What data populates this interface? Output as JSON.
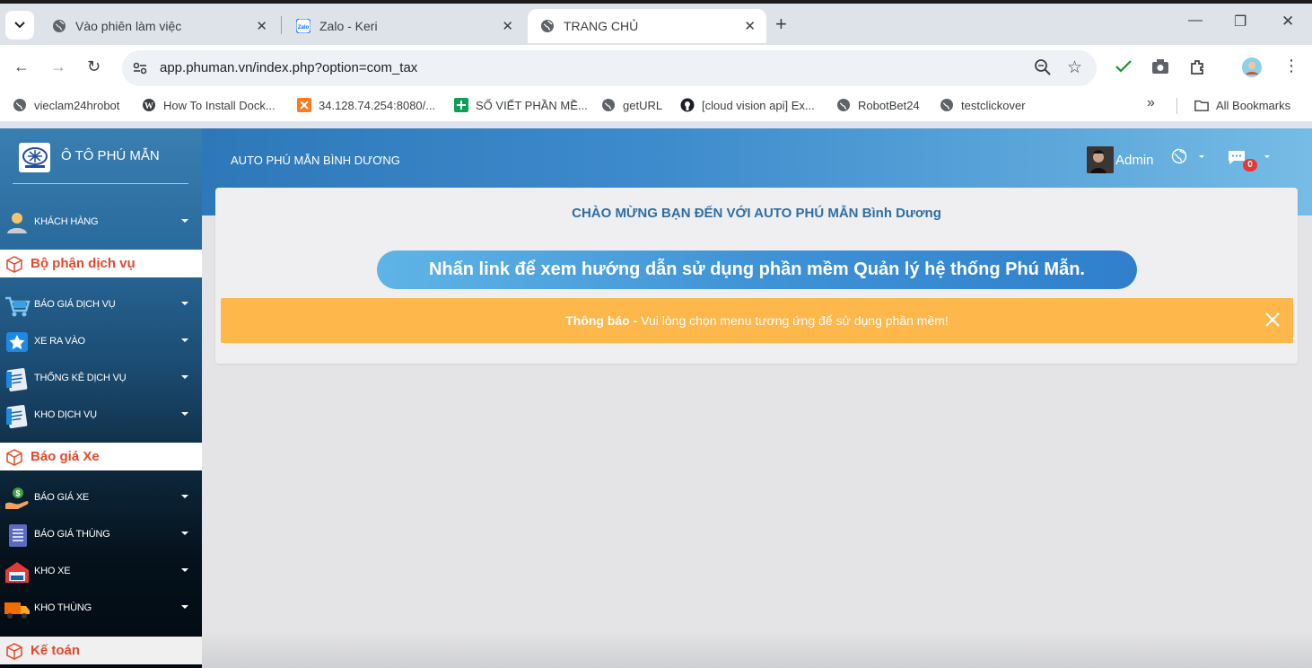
{
  "browser": {
    "tabs": [
      {
        "title": "Vào phiên làm việc",
        "active": false
      },
      {
        "title": "Zalo - Keri",
        "active": false
      },
      {
        "title": "TRANG CHỦ",
        "active": true
      }
    ],
    "url": "app.phuman.vn/index.php?option=com_tax",
    "bookmarks": [
      {
        "label": "vieclam24hrobot"
      },
      {
        "label": "How To Install Dock..."
      },
      {
        "label": "34.128.74.254:8080/..."
      },
      {
        "label": "SỐ VIẾT PHẦN MỀ..."
      },
      {
        "label": "getURL"
      },
      {
        "label": "[cloud vision api] Ex..."
      },
      {
        "label": "RobotBet24"
      },
      {
        "label": "testclickover"
      }
    ],
    "all_bookmarks_label": "All Bookmarks"
  },
  "sidebar": {
    "brand": "Ô TÔ PHÚ MẪN",
    "customer_item": "KHÁCH HÀNG",
    "sections": [
      {
        "title": "Bộ phận dịch vụ",
        "items": [
          "BÁO GIÁ DỊCH VỤ",
          "XE RA VÀO",
          "THỐNG KÊ DỊCH VỤ",
          "KHO DỊCH VỤ"
        ]
      },
      {
        "title": "Báo giá Xe",
        "items": [
          "BÁO GIÁ XE",
          "BÁO GIÁ THÙNG",
          "KHO XE",
          "KHO THÙNG"
        ]
      },
      {
        "title": "Kế toán",
        "items": []
      }
    ]
  },
  "header": {
    "site_name": "AUTO PHÚ MẪN BÌNH DƯƠNG",
    "user": "Admin",
    "message_count": "0"
  },
  "main": {
    "welcome": "CHÀO MỪNG BẠN ĐẾN VỚI AUTO PHÚ MẪN Bình Dương",
    "guide_link": "Nhấn link để xem hướng dẫn sử dụng phần mềm Quản lý hệ thống Phú Mẫn.",
    "alert_label": "Thông báo -",
    "alert_text": "Vui lòng chọn menu tương ứng để sử dụng phần mềm!"
  },
  "colors": {
    "accent_red": "#e0492c",
    "alert_orange": "#fdb74a",
    "header_blue": "#3d8acc"
  }
}
